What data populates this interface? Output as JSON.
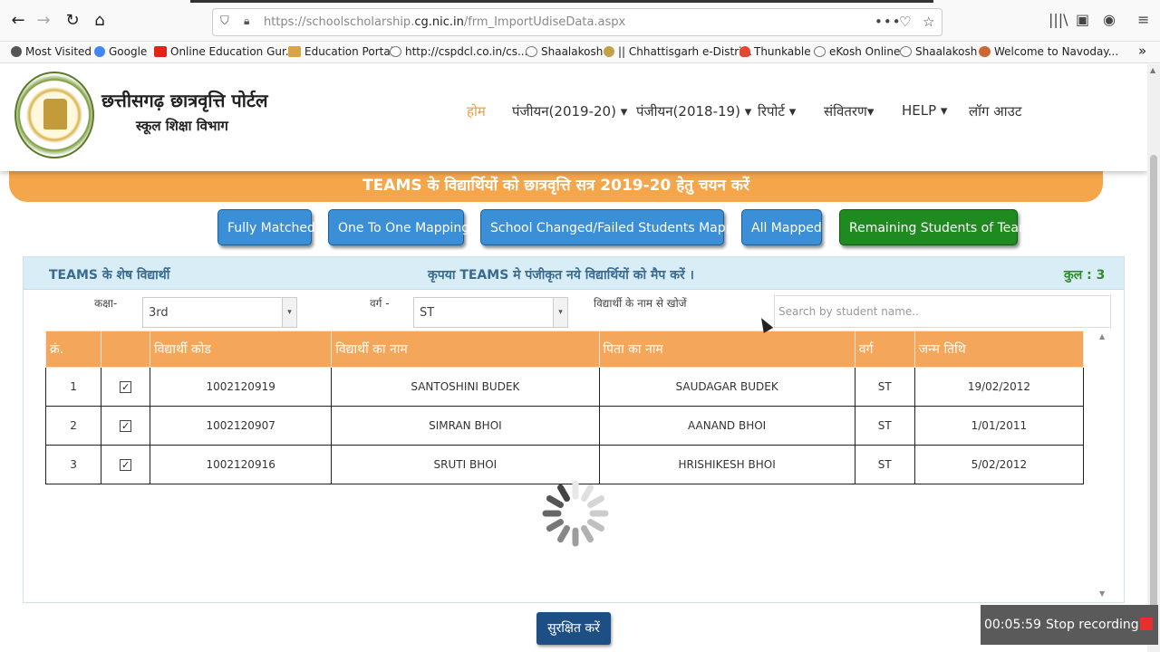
{
  "browser": {
    "url_prefix": "https://schoolscholarship.",
    "url_domain": "cg.nic.in",
    "url_suffix": "/frm_ImportUdiseData.aspx",
    "back_icon": "←",
    "forward_icon": "→",
    "reload_icon": "↻",
    "home_icon": "⌂",
    "more_icon": "•••",
    "pocket_icon": "♡",
    "star_icon": "☆",
    "library_icon": "|||\\",
    "sidebar_icon": "▣",
    "account_icon": "◉",
    "menu_icon": "≡",
    "bookmarks_overflow": "»"
  },
  "bookmarks": [
    {
      "label": "Most Visited",
      "color": "#555555"
    },
    {
      "label": "Google",
      "color": "#4285f4"
    },
    {
      "label": "Online Education Gur...",
      "color": "#e62117"
    },
    {
      "label": "Education Portal",
      "color": "#d9a441"
    },
    {
      "label": "http://cspdcl.co.in/cs...",
      "color": "#777777"
    },
    {
      "label": "Shaalakosh",
      "color": "#777777"
    },
    {
      "label": "|| Chhattisgarh e-Distri...",
      "color": "#c4a046"
    },
    {
      "label": "Thunkable",
      "color": "#e24a2f"
    },
    {
      "label": "eKosh Online",
      "color": "#777777"
    },
    {
      "label": "Shaalakosh",
      "color": "#777777"
    },
    {
      "label": "Welcome to Navoday...",
      "color": "#cc6633"
    }
  ],
  "header": {
    "title": "छत्तीसगढ़ छात्रवृत्ति पोर्टल",
    "subtitle": "स्कूल शिक्षा विभाग",
    "menu": [
      {
        "label": "होम",
        "active": true
      },
      {
        "label": "पंजीयन(2019-20) ▾"
      },
      {
        "label": "पंजीयन(2018-19) ▾"
      },
      {
        "label": "रिपोर्ट ▾"
      },
      {
        "label": "संवितरण▾"
      },
      {
        "label": "HELP ▾"
      },
      {
        "label": "लॉग आउट"
      }
    ]
  },
  "banner": "TEAMS के विद्यार्थियों को छात्रवृत्ति सत्र 2019-20 हेतु चयन करें",
  "actions": [
    "Fully Matched",
    "One To One Mapping",
    "School Changed/Failed Students Mapping",
    "All Mapped",
    "Remaining Students of Teams"
  ],
  "panel": {
    "left_title": "TEAMS के शेष विद्यार्थी",
    "center_title": "कृपया TEAMS मे पंजीकृत नये विद्यार्थियों को मैप करें ।",
    "count_label": "कुल : 3"
  },
  "filters": {
    "class_label": "कक्षा-",
    "class_value": "3rd",
    "category_label": "वर्ग -",
    "category_value": "ST",
    "search_label": "विद्यार्थी के नाम से खोजें",
    "search_placeholder": "Search by student name..",
    "caret": "▾"
  },
  "table": {
    "columns": [
      "क्रं.",
      "",
      "विद्यार्थी कोड",
      "विद्यार्थी का नाम",
      "पिता का नाम",
      "वर्ग",
      "जन्म तिथि"
    ],
    "check": "✓",
    "rows": [
      {
        "sno": "1",
        "code": "1002120919",
        "name": "SANTOSHINI BUDEK",
        "father": "SAUDAGAR BUDEK",
        "category": "ST",
        "dob": "19/02/2012"
      },
      {
        "sno": "2",
        "code": "1002120907",
        "name": "SIMRAN BHOI",
        "father": "AANAND BHOI",
        "category": "ST",
        "dob": "1/01/2011"
      },
      {
        "sno": "3",
        "code": "1002120916",
        "name": "SRUTI BHOI",
        "father": "HRISHIKESH BHOI",
        "category": "ST",
        "dob": "5/02/2012"
      }
    ]
  },
  "save_label": "सुरक्षित करें",
  "recorder": {
    "time": "00:05:59",
    "label": "Stop recording"
  }
}
